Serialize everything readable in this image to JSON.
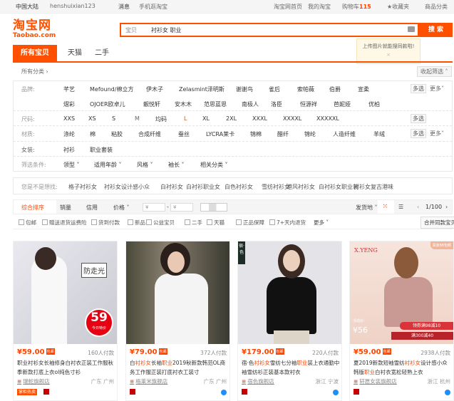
{
  "topbar": {
    "region": "中国大陆",
    "user": "henshuixian123",
    "messages": "消息",
    "mobile": "手机逛淘宝",
    "home": "淘宝网首页",
    "my": "我的淘宝",
    "cart": "购物车",
    "cart_count": "115",
    "fav": "收藏夹",
    "cats": "商品分类"
  },
  "logo": {
    "cn": "淘宝网",
    "en": "Taobao.com"
  },
  "search": {
    "category": "宝贝",
    "query": "衬衫女 职业",
    "button": "搜 索"
  },
  "tooltip": {
    "text": "上传图片就能搜同款啦!",
    "close": "×"
  },
  "tabs": [
    "所有宝贝",
    "天猫",
    "二手"
  ],
  "all_categories": "所有分类 ›",
  "fold": "收起筛选 ˄",
  "filters": {
    "brand_label": "品牌:",
    "brands_row1": [
      "芊艺",
      "Mefound/棉立方",
      "伊木子",
      "Zelasmint泽明斯",
      "谢谢鸟",
      "雀后",
      "索帕薇",
      "伯爵",
      "宣柔"
    ],
    "brands_row2": [
      "熠彩",
      "OJOER欧卓儿",
      "靓悦轩",
      "安木木",
      "范思蓝恩",
      "南极人",
      "洛臣",
      "恒源祥",
      "芭妮娅",
      "优柏"
    ],
    "size_label": "尺码:",
    "sizes": [
      "XXS",
      "XS",
      "S",
      "M",
      "均码",
      "L",
      "XL",
      "2XL",
      "XXXL",
      "XXXXL",
      "XXXXXL"
    ],
    "material_label": "材质:",
    "materials": [
      "涤纶",
      "棉",
      "粘胶",
      "合成纤维",
      "蚕丝",
      "LYCRA莱卡",
      "锦棉",
      "醋纤",
      "锦纶",
      "人造纤维",
      "羊绒"
    ],
    "women_label": "女装:",
    "women": [
      "衬衫",
      "职业套装"
    ],
    "cond_label": "筛选条件:",
    "conds": [
      "领型 ˅",
      "适用年龄 ˅",
      "风格 ˅",
      "袖长 ˅",
      "相关分类 ˅"
    ],
    "multi": "多选",
    "more": "更多˅"
  },
  "suggest": {
    "label": "您是不是想找:",
    "items": [
      "格子衬衫女",
      "衬衫女设计感小众",
      "白衬衫女",
      "白衬衫职业女",
      "白色衬衫女",
      "雪纺衬衫女",
      "港风衬衫女",
      "白衬衫女职业装",
      "衬衫女复古港味"
    ]
  },
  "sort": {
    "items": [
      "综合排序",
      "销量",
      "信用",
      "价格 ˅"
    ],
    "price_from": "¥",
    "price_to": "¥",
    "dash": "-",
    "ship": "发货地 ˅",
    "page": "1/100",
    "prev": "‹",
    "next": "›"
  },
  "checks": [
    "包邮",
    "赠送退货运费险",
    "货到付款",
    "新品",
    "公益宝贝",
    "二手",
    "天猫",
    "正品保障",
    "7+天内退货"
  ],
  "checks_more": "更多 ˅",
  "merge": "合并同款宝贝",
  "products": [
    {
      "price": "¥59.00",
      "tag": "包邮",
      "paid": "160人付款",
      "title": "职业衬衫女长袖修身白衬衣正装工作服秋季新款打底上衣ol纯色寸衫",
      "shop": "瑞蛇旗舰店",
      "loc": "广东 广州",
      "badge": "掌柜热卖",
      "overlay": "防走光",
      "sticker": "59",
      "sticker_sub": "今日特价"
    },
    {
      "price": "¥79.00",
      "tag": "包邮",
      "paid": "372人付款",
      "title_parts": [
        "白",
        "衬衫女",
        "长袖",
        "职业",
        "2019秋新款韩范OL商务工作服正装打底衬衣工装寸"
      ],
      "shop": "格莱米旗舰店",
      "loc": "广东 广州"
    },
    {
      "price": "¥179.00",
      "tag": "包邮",
      "paid": "220人付款",
      "title_parts": [
        "宿·色",
        "衬衫女",
        "雪纺七分袖",
        "职业",
        "装上衣通勤中袖雪纺衫正装基本款衬衣"
      ],
      "shop": "宿色旗舰店",
      "loc": "浙江 宁波",
      "overlay": "宿·色"
    },
    {
      "price": "¥59.00",
      "tag": "包邮",
      "paid": "2938人付款",
      "title_parts": [
        "夏2019新款短袖雪纺",
        "衬衫女",
        "设计感小众韩版",
        "职业",
        "白衬衣宽松轻熟上衣"
      ],
      "shop": "轩愿女装旗舰店",
      "loc": "浙江 杭州",
      "brand": "X.YENG",
      "corner": "買家88包郵",
      "promo_label": "活动价:",
      "promo_price": "¥56",
      "coupon": "领券满98减10",
      "discount": "满300减40"
    }
  ],
  "colors": {
    "accent": "#ff5000",
    "price": "#ff4400"
  }
}
